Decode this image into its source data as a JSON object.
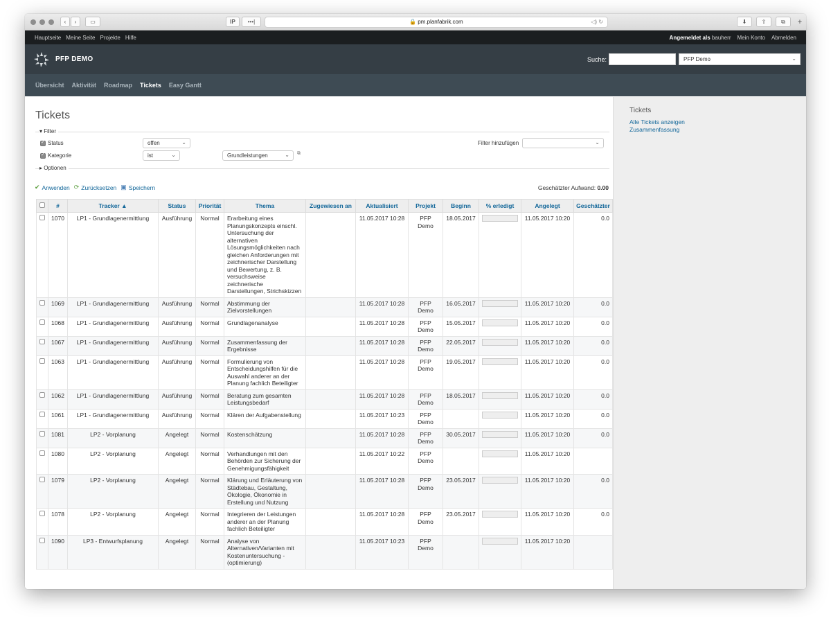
{
  "browser": {
    "url": "pm.planfabrik.com",
    "tab_label": "IP",
    "tab_more": "•••|"
  },
  "topmenu": {
    "left": [
      "Hauptseite",
      "Meine Seite",
      "Projekte",
      "Hilfe"
    ],
    "logged_in_prefix": "Angemeldet als",
    "user": "bauherr",
    "my_account": "Mein Konto",
    "logout": "Abmelden"
  },
  "header": {
    "brand": "PFP DEMO",
    "search_label": "Suche:",
    "search_value": "",
    "project_select": "PFP Demo"
  },
  "mainmenu": [
    {
      "label": "Übersicht",
      "selected": false
    },
    {
      "label": "Aktivität",
      "selected": false
    },
    {
      "label": "Roadmap",
      "selected": false
    },
    {
      "label": "Tickets",
      "selected": true
    },
    {
      "label": "Easy Gantt",
      "selected": false
    }
  ],
  "page_title": "Tickets",
  "filters": {
    "legend": "Filter",
    "options_legend": "Optionen",
    "status_label": "Status",
    "status_operator": "offen",
    "category_label": "Kategorie",
    "category_operator": "ist",
    "category_value": "Grundleistungen",
    "add_filter_label": "Filter hinzufügen",
    "add_filter_value": ""
  },
  "actions": {
    "apply": "Anwenden",
    "reset": "Zurücksetzen",
    "save": "Speichern"
  },
  "estimated_label": "Geschätzter Aufwand:",
  "estimated_value": "0.00",
  "table": {
    "headers": [
      "#",
      "Tracker ▲",
      "Status",
      "Priorität",
      "Thema",
      "Zugewiesen an",
      "Aktualisiert",
      "Projekt",
      "Beginn",
      "% erledigt",
      "Angelegt",
      "Geschätzter"
    ],
    "rows": [
      {
        "id": "1070",
        "tracker": "LP1 - Grundlagenermittlung",
        "status": "Ausführung",
        "priority": "Normal",
        "subject": "Erarbeitung eines Planungskonzepts einschl. Untersuchung der alternativen Lösungsmöglichkeiten nach gleichen Anforderungen mit zeichnerischer Darstellung und Bewertung, z. B. versuchsweise zeichnerische Darstellungen, Strichskizzen",
        "assigned": "",
        "updated": "11.05.2017 10:28",
        "project": "PFP Demo",
        "start": "18.05.2017",
        "done": 0,
        "created": "11.05.2017 10:20",
        "estimated": "0.0"
      },
      {
        "id": "1069",
        "tracker": "LP1 - Grundlagenermittlung",
        "status": "Ausführung",
        "priority": "Normal",
        "subject": "Abstimmung der Zielvorstellungen",
        "assigned": "",
        "updated": "11.05.2017 10:28",
        "project": "PFP Demo",
        "start": "16.05.2017",
        "done": 0,
        "created": "11.05.2017 10:20",
        "estimated": "0.0"
      },
      {
        "id": "1068",
        "tracker": "LP1 - Grundlagenermittlung",
        "status": "Ausführung",
        "priority": "Normal",
        "subject": "Grundlagenanalyse",
        "assigned": "",
        "updated": "11.05.2017 10:28",
        "project": "PFP Demo",
        "start": "15.05.2017",
        "done": 0,
        "created": "11.05.2017 10:20",
        "estimated": "0.0"
      },
      {
        "id": "1067",
        "tracker": "LP1 - Grundlagenermittlung",
        "status": "Ausführung",
        "priority": "Normal",
        "subject": "Zusammenfassung der Ergebnisse",
        "assigned": "",
        "updated": "11.05.2017 10:28",
        "project": "PFP Demo",
        "start": "22.05.2017",
        "done": 0,
        "created": "11.05.2017 10:20",
        "estimated": "0.0"
      },
      {
        "id": "1063",
        "tracker": "LP1 - Grundlagenermittlung",
        "status": "Ausführung",
        "priority": "Normal",
        "subject": "Formulierung von Entscheidungshilfen für die Auswahl anderer an der Planung fachlich Beteiligter",
        "assigned": "",
        "updated": "11.05.2017 10:28",
        "project": "PFP Demo",
        "start": "19.05.2017",
        "done": 0,
        "created": "11.05.2017 10:20",
        "estimated": "0.0"
      },
      {
        "id": "1062",
        "tracker": "LP1 - Grundlagenermittlung",
        "status": "Ausführung",
        "priority": "Normal",
        "subject": "Beratung zum gesamten Leistungsbedarf",
        "assigned": "",
        "updated": "11.05.2017 10:28",
        "project": "PFP Demo",
        "start": "18.05.2017",
        "done": 0,
        "created": "11.05.2017 10:20",
        "estimated": "0.0"
      },
      {
        "id": "1061",
        "tracker": "LP1 - Grundlagenermittlung",
        "status": "Ausführung",
        "priority": "Normal",
        "subject": "Klären der Aufgabenstellung",
        "assigned": "",
        "updated": "11.05.2017 10:23",
        "project": "PFP Demo",
        "start": "",
        "done": 0,
        "created": "11.05.2017 10:20",
        "estimated": "0.0"
      },
      {
        "id": "1081",
        "tracker": "LP2 - Vorplanung",
        "status": "Angelegt",
        "priority": "Normal",
        "subject": "Kostenschätzung",
        "assigned": "",
        "updated": "11.05.2017 10:28",
        "project": "PFP Demo",
        "start": "30.05.2017",
        "done": 0,
        "created": "11.05.2017 10:20",
        "estimated": "0.0"
      },
      {
        "id": "1080",
        "tracker": "LP2 - Vorplanung",
        "status": "Angelegt",
        "priority": "Normal",
        "subject": "Verhandlungen mit den Behörden zur Sicherung der Genehmigungsfähigkeit",
        "assigned": "",
        "updated": "11.05.2017 10:22",
        "project": "PFP Demo",
        "start": "",
        "done": 0,
        "created": "11.05.2017 10:20",
        "estimated": ""
      },
      {
        "id": "1079",
        "tracker": "LP2 - Vorplanung",
        "status": "Angelegt",
        "priority": "Normal",
        "subject": "Klärung und Erläuterung von Städtebau, Gestaltung, Ökologie, Ökonomie in Erstellung und Nutzung",
        "assigned": "",
        "updated": "11.05.2017 10:28",
        "project": "PFP Demo",
        "start": "23.05.2017",
        "done": 0,
        "created": "11.05.2017 10:20",
        "estimated": "0.0"
      },
      {
        "id": "1078",
        "tracker": "LP2 - Vorplanung",
        "status": "Angelegt",
        "priority": "Normal",
        "subject": "Integrieren der Leistungen anderer an der Planung fachlich Beteiligter",
        "assigned": "",
        "updated": "11.05.2017 10:28",
        "project": "PFP Demo",
        "start": "23.05.2017",
        "done": 0,
        "created": "11.05.2017 10:20",
        "estimated": "0.0"
      },
      {
        "id": "1090",
        "tracker": "LP3 - Entwurfsplanung",
        "status": "Angelegt",
        "priority": "Normal",
        "subject": "Analyse von Alternativen/Varianten mit Kostenuntersuchung - (optimierung)",
        "assigned": "",
        "updated": "11.05.2017 10:23",
        "project": "PFP Demo",
        "start": "",
        "done": 0,
        "created": "11.05.2017 10:20",
        "estimated": ""
      }
    ]
  },
  "sidebar": {
    "title": "Tickets",
    "links": [
      "Alle Tickets anzeigen",
      "Zusammenfassung"
    ]
  }
}
